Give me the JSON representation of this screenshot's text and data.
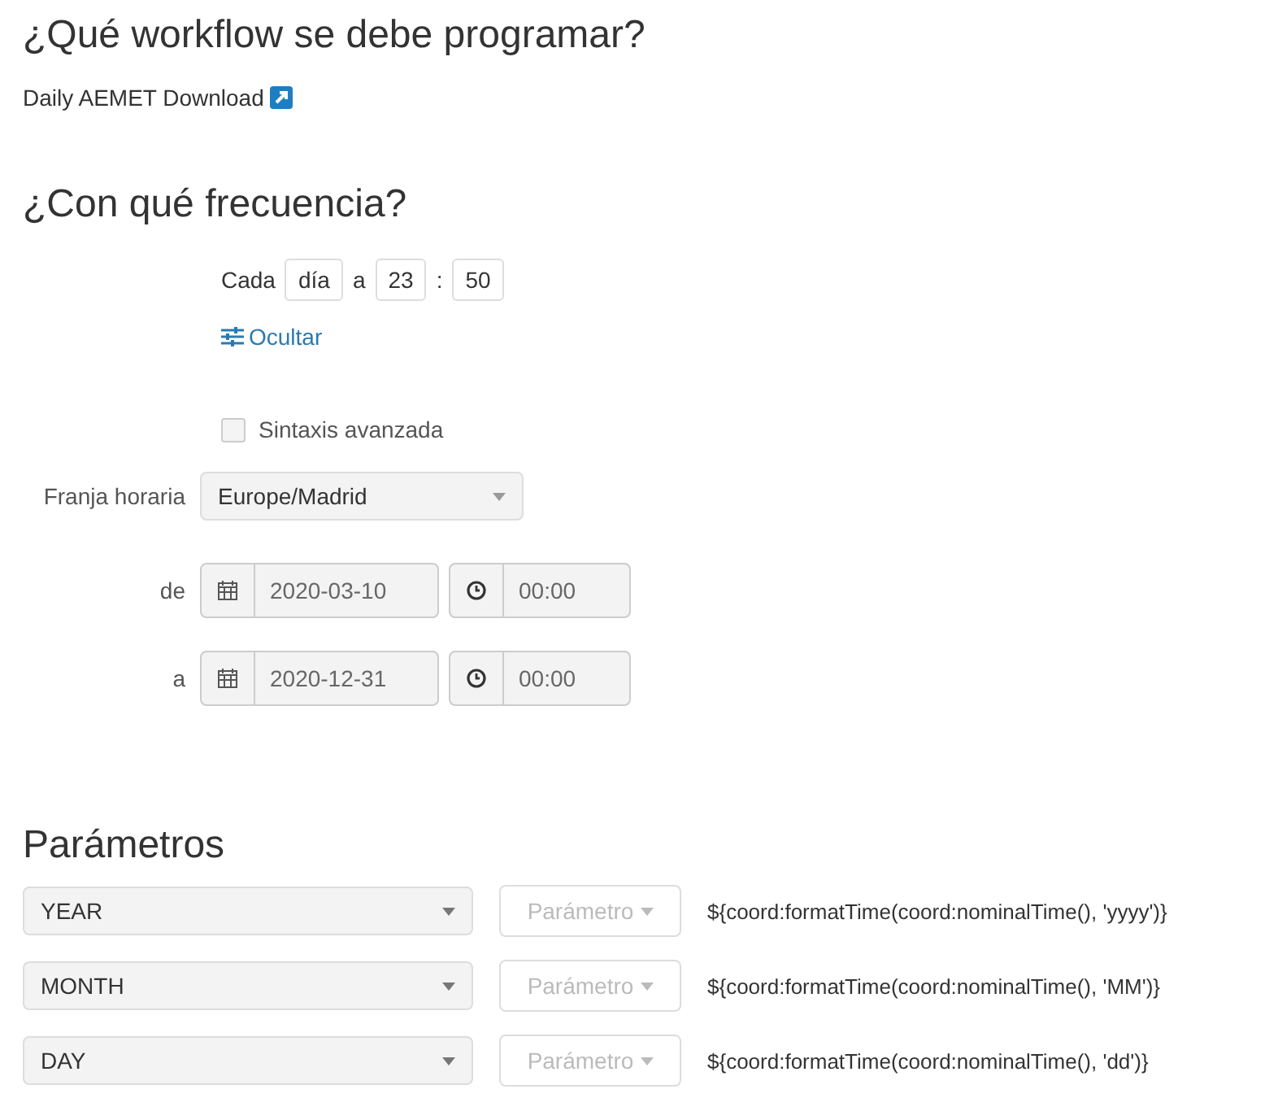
{
  "workflow_section": {
    "title": "¿Qué workflow se debe programar?",
    "workflow_link": "Daily AEMET Download"
  },
  "frequency_section": {
    "title": "¿Con qué frecuencia?",
    "every_label": "Cada",
    "unit": "día",
    "at_label": "a",
    "hour": "23",
    "separator": ":",
    "minute": "50",
    "toggle_link": "Ocultar",
    "advanced_syntax": {
      "label": "Sintaxis avanzada",
      "checked": false
    },
    "timezone": {
      "label": "Franja horaria",
      "value": "Europe/Madrid"
    },
    "ranges": [
      {
        "label": "de",
        "date": "2020-03-10",
        "time": "00:00"
      },
      {
        "label": "a",
        "date": "2020-12-31",
        "time": "00:00"
      }
    ]
  },
  "parameters_section": {
    "title": "Parámetros",
    "rows": [
      {
        "name": "YEAR",
        "type_button": "Parámetro",
        "value": "${coord:formatTime(coord:nominalTime(), 'yyyy')}"
      },
      {
        "name": "MONTH",
        "type_button": "Parámetro",
        "value": "${coord:formatTime(coord:nominalTime(), 'MM')}"
      },
      {
        "name": "DAY",
        "type_button": "Parámetro",
        "value": "${coord:formatTime(coord:nominalTime(), 'dd')}"
      }
    ]
  }
}
